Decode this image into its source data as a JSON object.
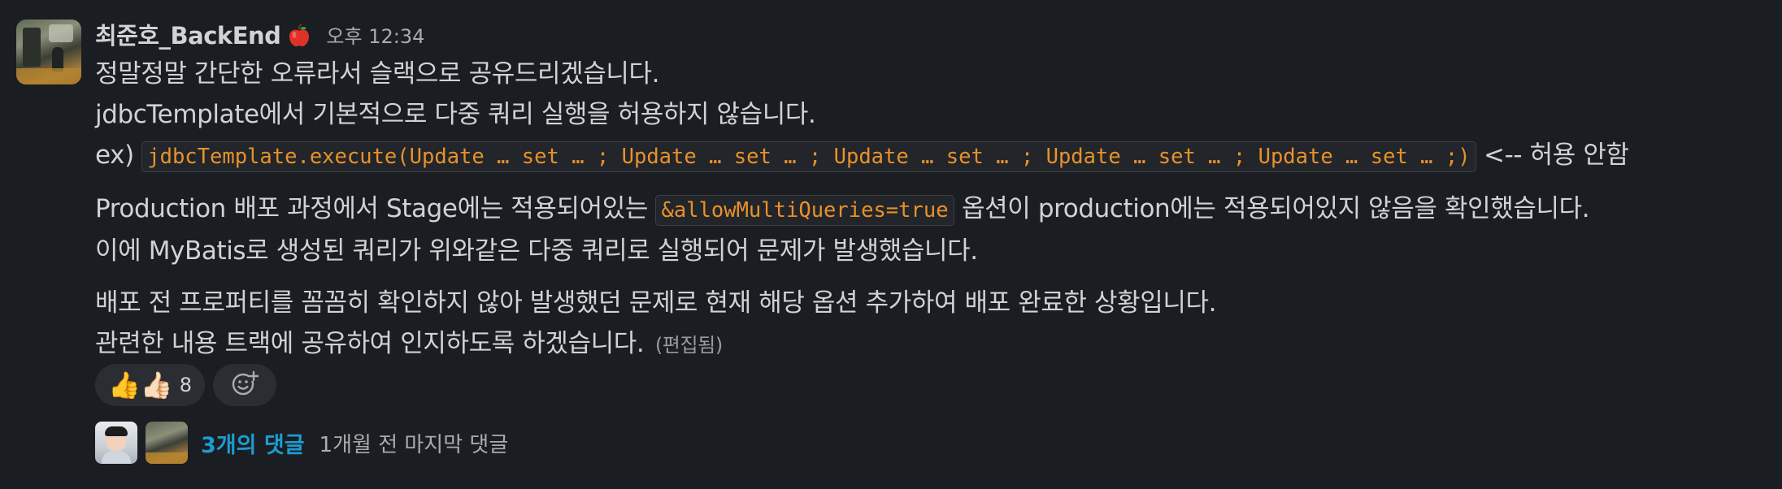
{
  "message": {
    "author": "최준호_BackEnd",
    "status_emoji": "apple-icon",
    "timestamp": "오후 12:34",
    "lines": {
      "l1": "정말정말 간단한 오류라서 슬랙으로 공유드리겠습니다.",
      "l2": "jdbcTemplate에서 기본적으로 다중 쿼리 실행을 허용하지 않습니다.",
      "l3_prefix": "ex) ",
      "l3_code": "jdbcTemplate.execute(Update … set … ; Update … set … ; Update … set … ; Update … set … ; Update … set … ;)",
      "l3_suffix": " <-- 허용 안함",
      "l4_prefix": "Production 배포 과정에서 Stage에는 적용되어있는 ",
      "l4_code": "&allowMultiQueries=true",
      "l4_suffix": " 옵션이 production에는 적용되어있지 않음을 확인했습니다.",
      "l5": "이에 MyBatis로 생성된 쿼리가 위와같은 다중 쿼리로 실행되어 문제가 발생했습니다.",
      "l6": "배포 전 프로퍼티를 꼼꼼히 확인하지 않아 발생했던 문제로 현재 해당 옵션 추가하여 배포 완료한 상황입니다.",
      "l7": "관련한 내용 트랙에 공유하여 인지하도록 하겠습니다.",
      "edited": "(편집됨)"
    },
    "reactions": [
      {
        "emojis": "👍👍🏻",
        "count": "8"
      }
    ],
    "add_reaction_icon": "add-reaction-icon",
    "thread": {
      "replies": "3개의 댓글",
      "last_reply": "1개월 전 마지막 댓글"
    }
  }
}
